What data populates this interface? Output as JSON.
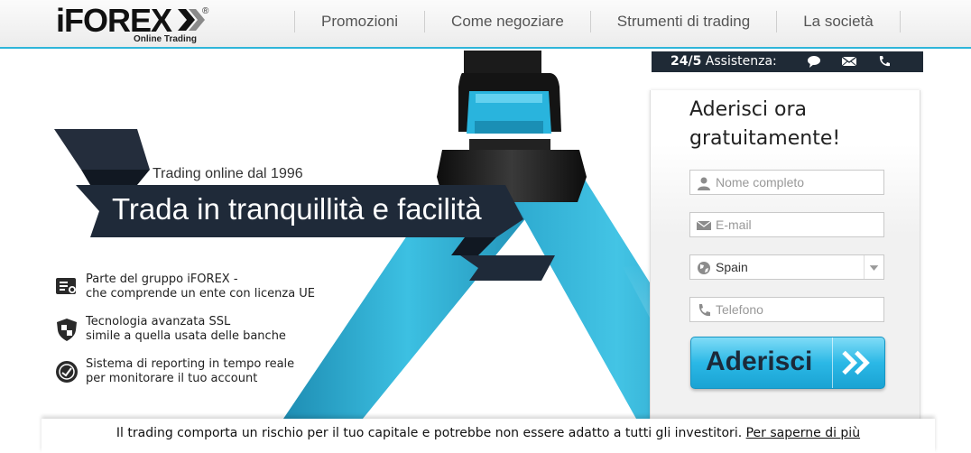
{
  "brand": {
    "name": "iFOREX",
    "registered": "®",
    "tagline": "Online Trading"
  },
  "nav": {
    "items": [
      "Promozioni",
      "Come negoziare",
      "Strumenti di trading",
      "La società"
    ]
  },
  "assistance": {
    "hours": "24/5",
    "label": "Assistenza:",
    "icons": [
      "chat-icon",
      "mail-icon",
      "phone-icon"
    ]
  },
  "hero": {
    "since": "Trading online dal 1996",
    "title": "Trada in tranquillità e facilità"
  },
  "features": [
    {
      "icon": "certificate-icon",
      "line1": "Parte del gruppo iFOREX -",
      "line2": "che comprende un ente con licenza UE"
    },
    {
      "icon": "shield-icon",
      "line1": "Tecnologia avanzata SSL",
      "line2": "simile a quella usata delle banche"
    },
    {
      "icon": "clock-icon",
      "line1": "Sistema di reporting in tempo reale",
      "line2": "per monitorare il tuo account"
    }
  ],
  "form": {
    "title_line1": "Aderisci ora",
    "title_line2": "gratuitamente!",
    "name_placeholder": "Nome completo",
    "email_placeholder": "E-mail",
    "country_value": "Spain",
    "phone_placeholder": "Telefono",
    "submit_label": "Aderisci"
  },
  "footer": {
    "disclaimer": "Il trading comporta un rischio per il tuo capitale e potrebbe non essere adatto a tutti gli investitori.",
    "link": "Per saperne di più"
  },
  "colors": {
    "accent": "#2fb5d9",
    "belt": "#36b3d6",
    "dark": "#1f2a36"
  }
}
